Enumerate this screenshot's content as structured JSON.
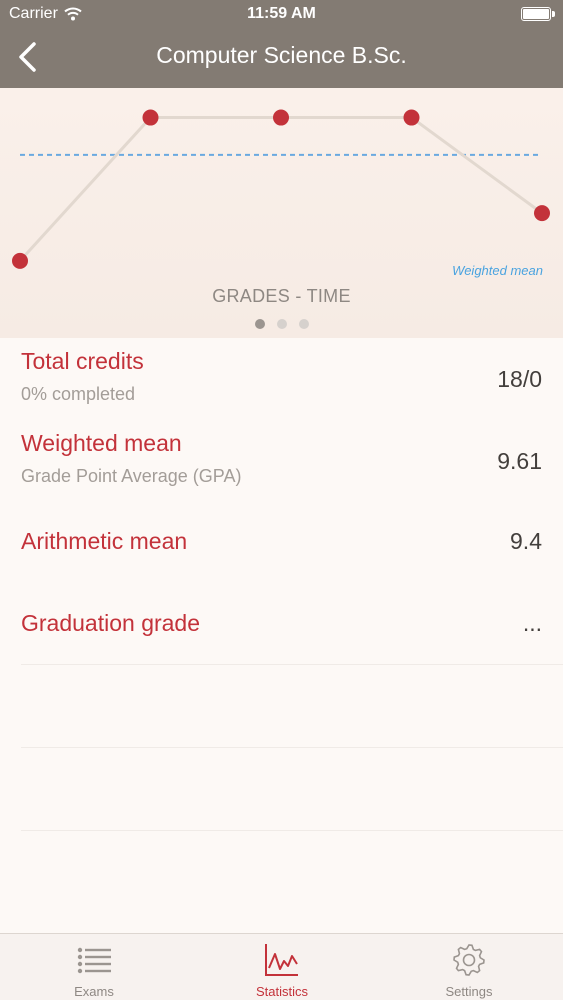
{
  "status_bar": {
    "carrier": "Carrier",
    "time": "11:59 AM"
  },
  "nav": {
    "title": "Computer Science B.Sc."
  },
  "chart_data": {
    "type": "line",
    "x": [
      1,
      2,
      3,
      4,
      5
    ],
    "series": [
      {
        "values": [
          8.5,
          10,
          10,
          10,
          9
        ]
      }
    ],
    "reference_line": {
      "label": "Weighted mean",
      "value": 9.61
    },
    "title": "GRADES - TIME",
    "ylim": [
      8.3,
      10.1
    ],
    "grid": false,
    "colors": {
      "line": "#e2d8cf",
      "points": "#c3323a",
      "reference": "#6aa9e0"
    }
  },
  "pager": {
    "count": 3,
    "active": 0
  },
  "stats": [
    {
      "title": "Total credits",
      "subtitle": "0% completed",
      "value": "18/0"
    },
    {
      "title": "Weighted mean",
      "subtitle": "Grade Point Average (GPA)",
      "value": "9.61"
    },
    {
      "title": "Arithmetic mean",
      "subtitle": "",
      "value": "9.4"
    },
    {
      "title": "Graduation grade",
      "subtitle": "",
      "value": "..."
    }
  ],
  "tabs": [
    {
      "label": "Exams",
      "icon": "list-icon"
    },
    {
      "label": "Statistics",
      "icon": "chart-icon",
      "active": true
    },
    {
      "label": "Settings",
      "icon": "gear-icon"
    }
  ],
  "colors": {
    "accent": "#c3323a",
    "nav_bar": "#837b73",
    "background": "#fdf9f6"
  }
}
